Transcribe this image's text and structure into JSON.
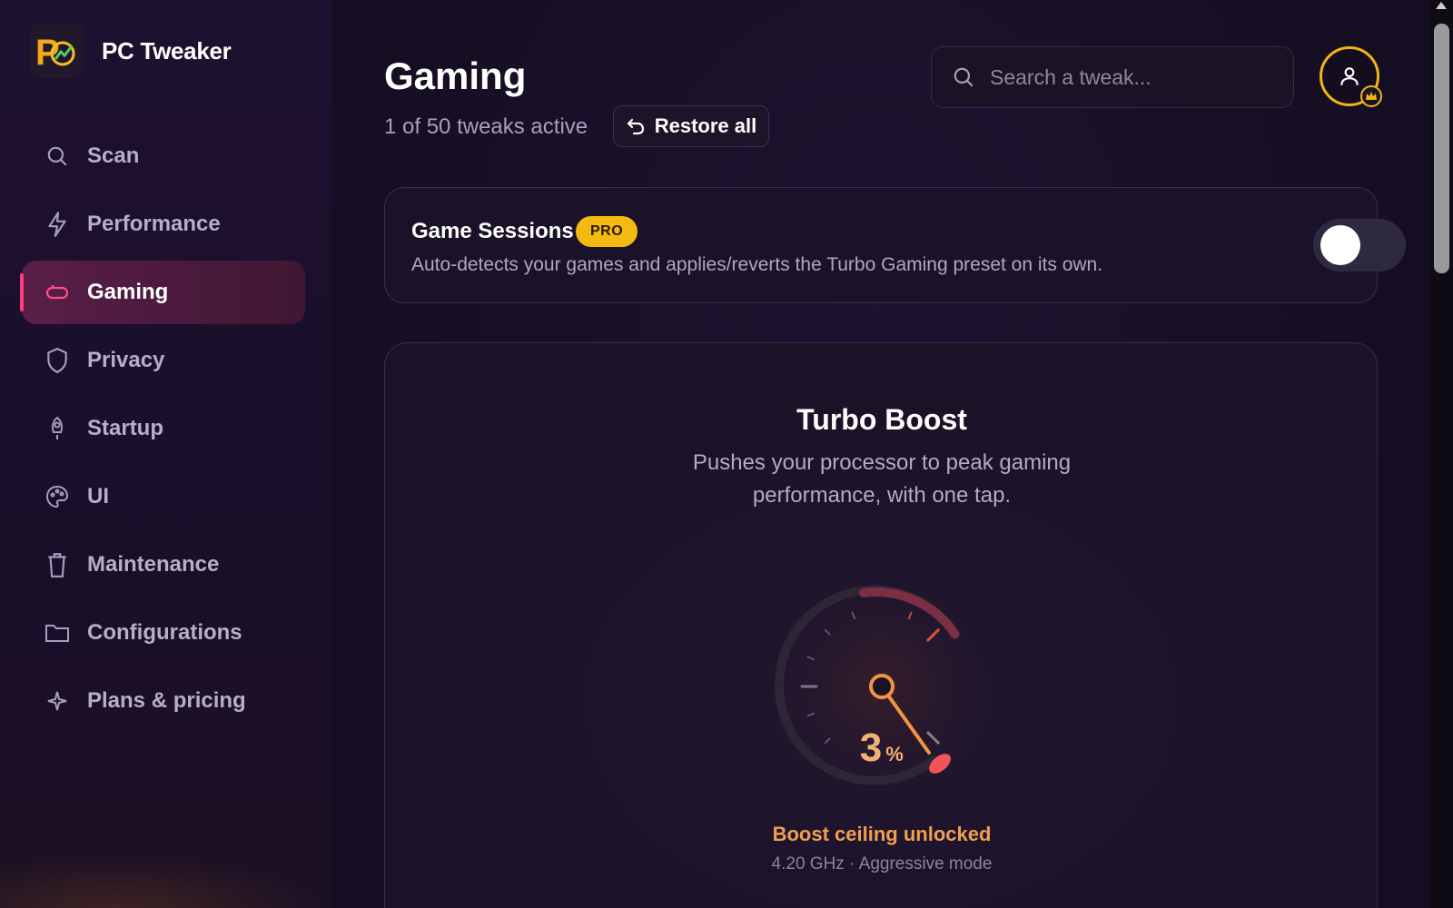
{
  "app": {
    "name": "PC Tweaker"
  },
  "sidebar": {
    "items": [
      {
        "label": "Scan",
        "icon": "search-icon",
        "active": false
      },
      {
        "label": "Performance",
        "icon": "bolt-icon",
        "active": false
      },
      {
        "label": "Gaming",
        "icon": "gamepad-icon",
        "active": true
      },
      {
        "label": "Privacy",
        "icon": "shield-icon",
        "active": false
      },
      {
        "label": "Startup",
        "icon": "rocket-icon",
        "active": false
      },
      {
        "label": "UI",
        "icon": "palette-icon",
        "active": false
      },
      {
        "label": "Maintenance",
        "icon": "trash-icon",
        "active": false
      },
      {
        "label": "Configurations",
        "icon": "folder-icon",
        "active": false
      },
      {
        "label": "Plans & pricing",
        "icon": "sparkle-icon",
        "active": false
      }
    ]
  },
  "header": {
    "title": "Gaming",
    "subtitle": "1 of 50 tweaks active",
    "restore_label": "Restore all",
    "search_placeholder": "Search a tweak..."
  },
  "game_sessions": {
    "title": "Game Sessions",
    "badge": "PRO",
    "description": "Auto-detects your games and applies/reverts the Turbo Gaming preset on its own.",
    "enabled": false
  },
  "turbo_boost": {
    "title": "Turbo Boost",
    "description": "Pushes your processor to peak gaming performance, with one tap.",
    "value": "3",
    "unit": "%",
    "status": "Boost ceiling unlocked",
    "detail": "4.20 GHz · Aggressive mode"
  },
  "colors": {
    "accent": "#ff3c7c",
    "pro_badge": "#f3bb12",
    "gauge_orange": "#f08a3a",
    "status_text": "#f0a04f"
  }
}
